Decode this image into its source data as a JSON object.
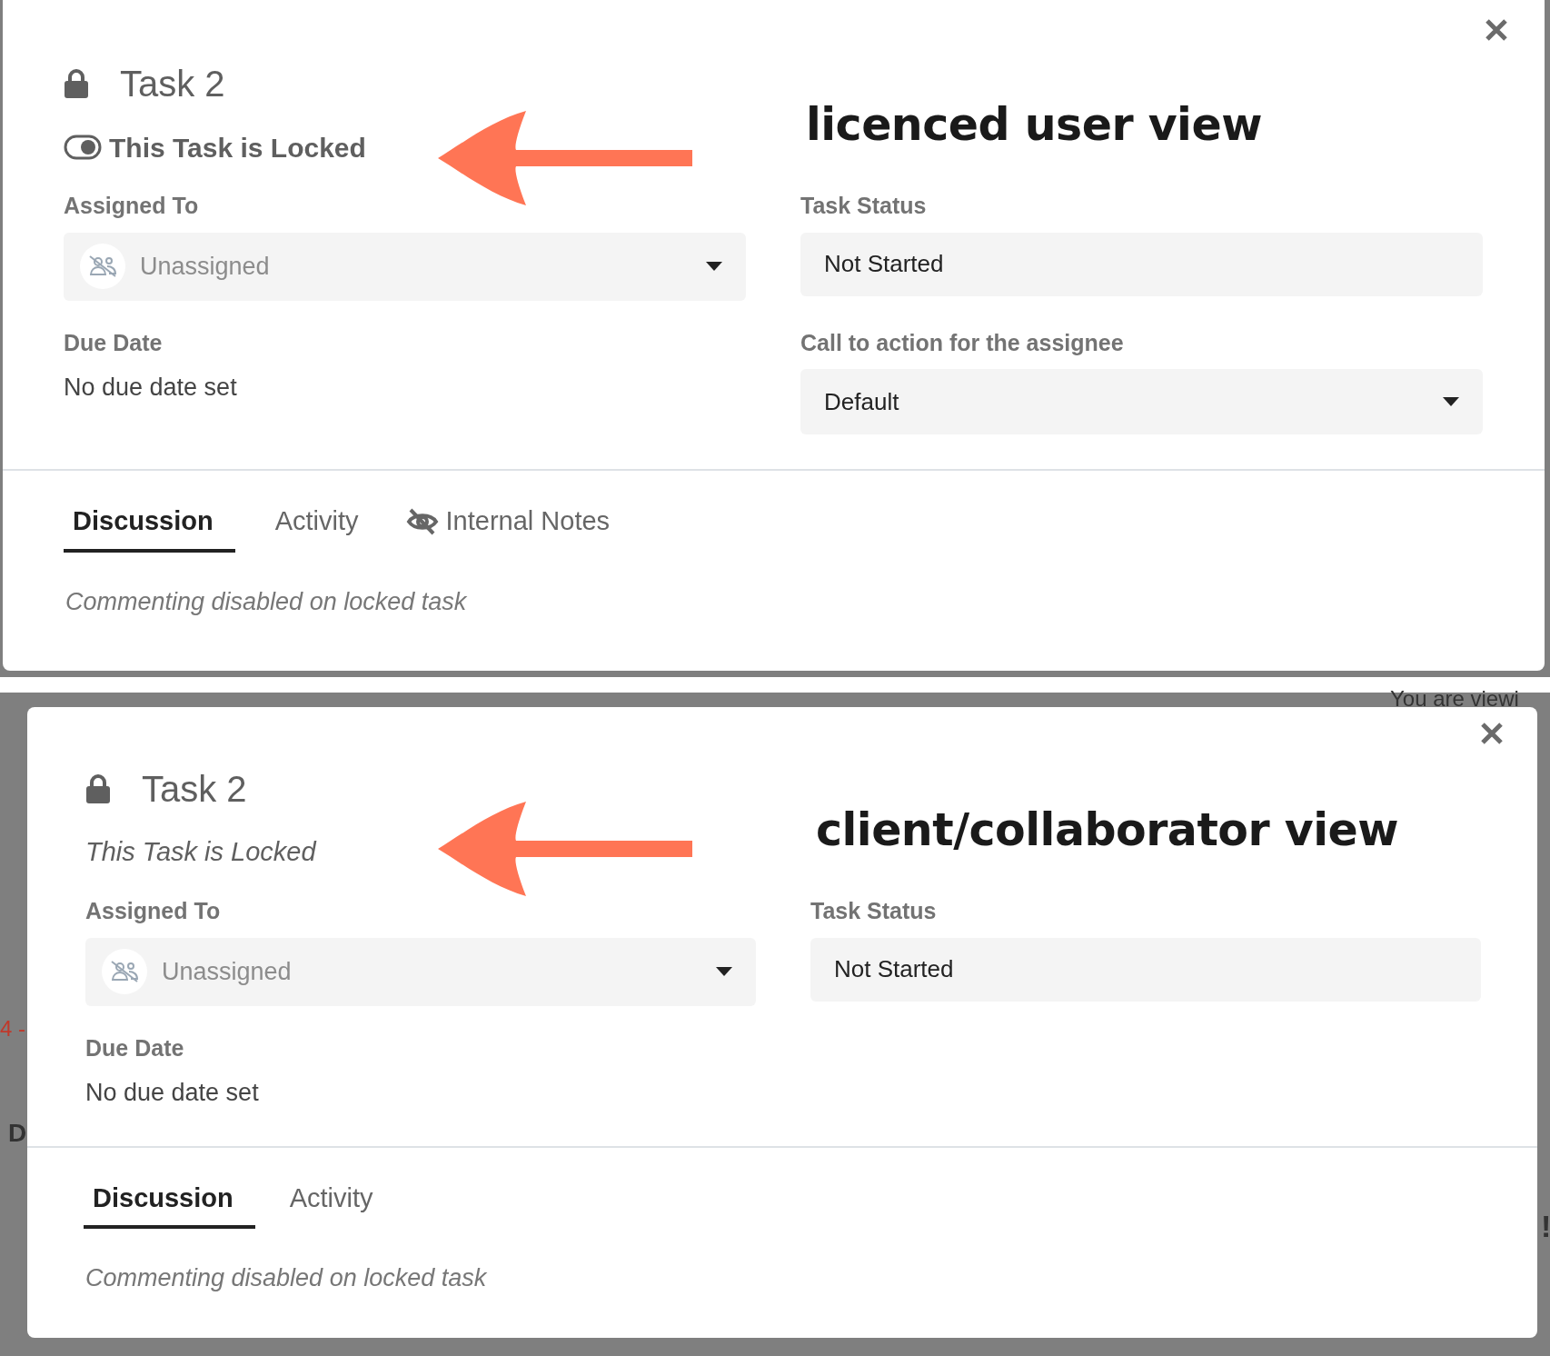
{
  "panels": [
    {
      "caption": "licenced user view",
      "title": "Task 2",
      "lock": {
        "kind": "toggle",
        "label": "This Task is Locked",
        "on": true
      },
      "left_fields": [
        {
          "kind": "assignee",
          "label": "Assigned To",
          "placeholder": "Unassigned"
        },
        {
          "kind": "static",
          "label": "Due Date",
          "value": "No due date set"
        }
      ],
      "right_fields": [
        {
          "kind": "input",
          "label": "Task Status",
          "value": "Not Started"
        },
        {
          "kind": "select",
          "label": "Call to action for the assignee",
          "value": "Default"
        }
      ],
      "tabs": [
        {
          "label": "Discussion",
          "selected": true,
          "private": false
        },
        {
          "label": "Activity",
          "selected": false,
          "private": false
        },
        {
          "label": "Internal Notes",
          "selected": false,
          "private": true
        }
      ],
      "notice": "Commenting disabled on locked task"
    },
    {
      "caption": "client/collaborator view",
      "title": "Task 2",
      "lock": {
        "kind": "note",
        "label": "This Task is Locked"
      },
      "left_fields": [
        {
          "kind": "assignee",
          "label": "Assigned To",
          "placeholder": "Unassigned"
        },
        {
          "kind": "static",
          "label": "Due Date",
          "value": "No due date set"
        }
      ],
      "right_fields": [
        {
          "kind": "input",
          "label": "Task Status",
          "value": "Not Started"
        }
      ],
      "tabs": [
        {
          "label": "Discussion",
          "selected": true,
          "private": false
        },
        {
          "label": "Activity",
          "selected": false,
          "private": false
        }
      ],
      "notice": "Commenting disabled on locked task",
      "backdrop_texts": [
        "You are viewi",
        "4 -",
        "D",
        "!"
      ]
    }
  ]
}
